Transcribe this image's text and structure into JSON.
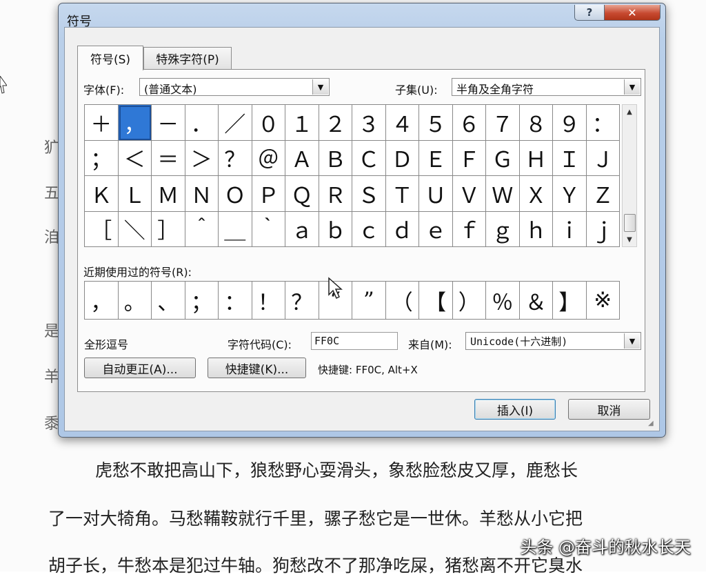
{
  "document": {
    "margin_chars": [
      "犷",
      "五",
      "洎",
      "是",
      "羊",
      "黍"
    ],
    "lines": [
      "虎愁不敢把高山下，狼愁野心耍滑头，象愁脸愁皮又厚，鹿愁长",
      "了一对大犄角。马愁鞴鞍就行千里，骡子愁它是一世休。羊愁从小它把",
      "胡子长，牛愁本是犯过牛轴。狗愁改不了那净吃屎，猪愁离不开它臭水"
    ]
  },
  "watermark": "头条 @奋斗的秋水长天",
  "dialog": {
    "title": "符号",
    "help_icon": "?",
    "close_icon": "✕",
    "tabs": [
      {
        "label": "符号(S)",
        "active": true
      },
      {
        "label": "特殊字符(P)",
        "active": false
      }
    ],
    "font_label": "字体(F):",
    "font_value": "(普通文本)",
    "subset_label": "子集(U):",
    "subset_value": "半角及全角字符",
    "symbols": [
      "＋",
      "，",
      "－",
      "．",
      "／",
      "０",
      "１",
      "２",
      "３",
      "４",
      "５",
      "６",
      "７",
      "８",
      "９",
      "：",
      "；",
      "＜",
      "＝",
      "＞",
      "？",
      "＠",
      "Ａ",
      "Ｂ",
      "Ｃ",
      "Ｄ",
      "Ｅ",
      "Ｆ",
      "Ｇ",
      "Ｈ",
      "Ｉ",
      "Ｊ",
      "Ｋ",
      "Ｌ",
      "Ｍ",
      "Ｎ",
      "Ｏ",
      "Ｐ",
      "Ｑ",
      "Ｒ",
      "Ｓ",
      "Ｔ",
      "Ｕ",
      "Ｖ",
      "Ｗ",
      "Ｘ",
      "Ｙ",
      "Ｚ",
      "［",
      "＼",
      "］",
      "＾",
      "＿",
      "｀",
      "ａ",
      "ｂ",
      "ｃ",
      "ｄ",
      "ｅ",
      "ｆ",
      "ｇ",
      "ｈ",
      "ｉ",
      "ｊ"
    ],
    "selected_index": 1,
    "recent_label": "近期使用过的符号(R):",
    "recent_symbols": [
      "，",
      "。",
      "、",
      "；",
      "：",
      "！",
      "？",
      "“",
      "”",
      "（",
      "【",
      "）",
      "％",
      "＆",
      "】",
      "※"
    ],
    "char_name": "全形逗号",
    "char_code_label": "字符代码(C):",
    "char_code_value": "FF0C",
    "from_label": "来自(M):",
    "from_value": "Unicode(十六进制)",
    "autocorrect_button": "自动更正(A)...",
    "shortcut_button": "快捷键(K)...",
    "shortcut_text": "快捷键: FF0C, Alt+X",
    "insert_button": "插入(I)",
    "cancel_button": "取消"
  }
}
